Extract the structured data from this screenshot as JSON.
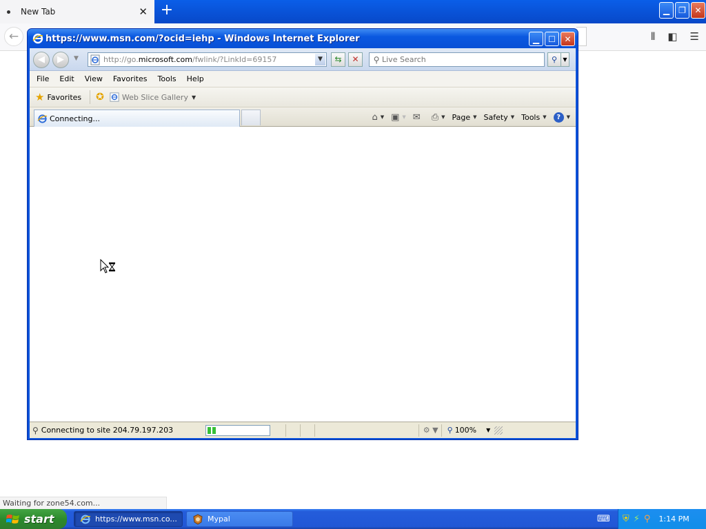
{
  "firefox": {
    "tab_title": "New Tab",
    "new_tab_symbol": "+",
    "status_text": "Waiting for zone54.com..."
  },
  "ie": {
    "window_title": "https://www.msn.com/?ocid=iehp - Windows Internet Explorer",
    "address": {
      "prefix": "http://go.",
      "domain": "microsoft.com",
      "suffix": "/fwlink/?LinkId=69157"
    },
    "search_placeholder": "Live Search",
    "menu": [
      "File",
      "Edit",
      "View",
      "Favorites",
      "Tools",
      "Help"
    ],
    "favorites_label": "Favorites",
    "web_slice_gallery": "Web Slice Gallery",
    "tab_label": "Connecting...",
    "command_bar": {
      "page": "Page",
      "safety": "Safety",
      "tools": "Tools"
    },
    "status_text": "Connecting to site 204.79.197.203",
    "progress": 0.15,
    "zoom": "100%"
  },
  "taskbar": {
    "start_label": "start",
    "tasks": [
      {
        "label": "https://www.msn.co...",
        "icon": "ie-icon"
      },
      {
        "label": "Mypal",
        "icon": "mypal-icon"
      }
    ],
    "clock": "1:14 PM"
  },
  "colors": {
    "xp_blue": "#0a58e0",
    "start_green": "#2c8a2c",
    "progress_green": "#36c036"
  }
}
